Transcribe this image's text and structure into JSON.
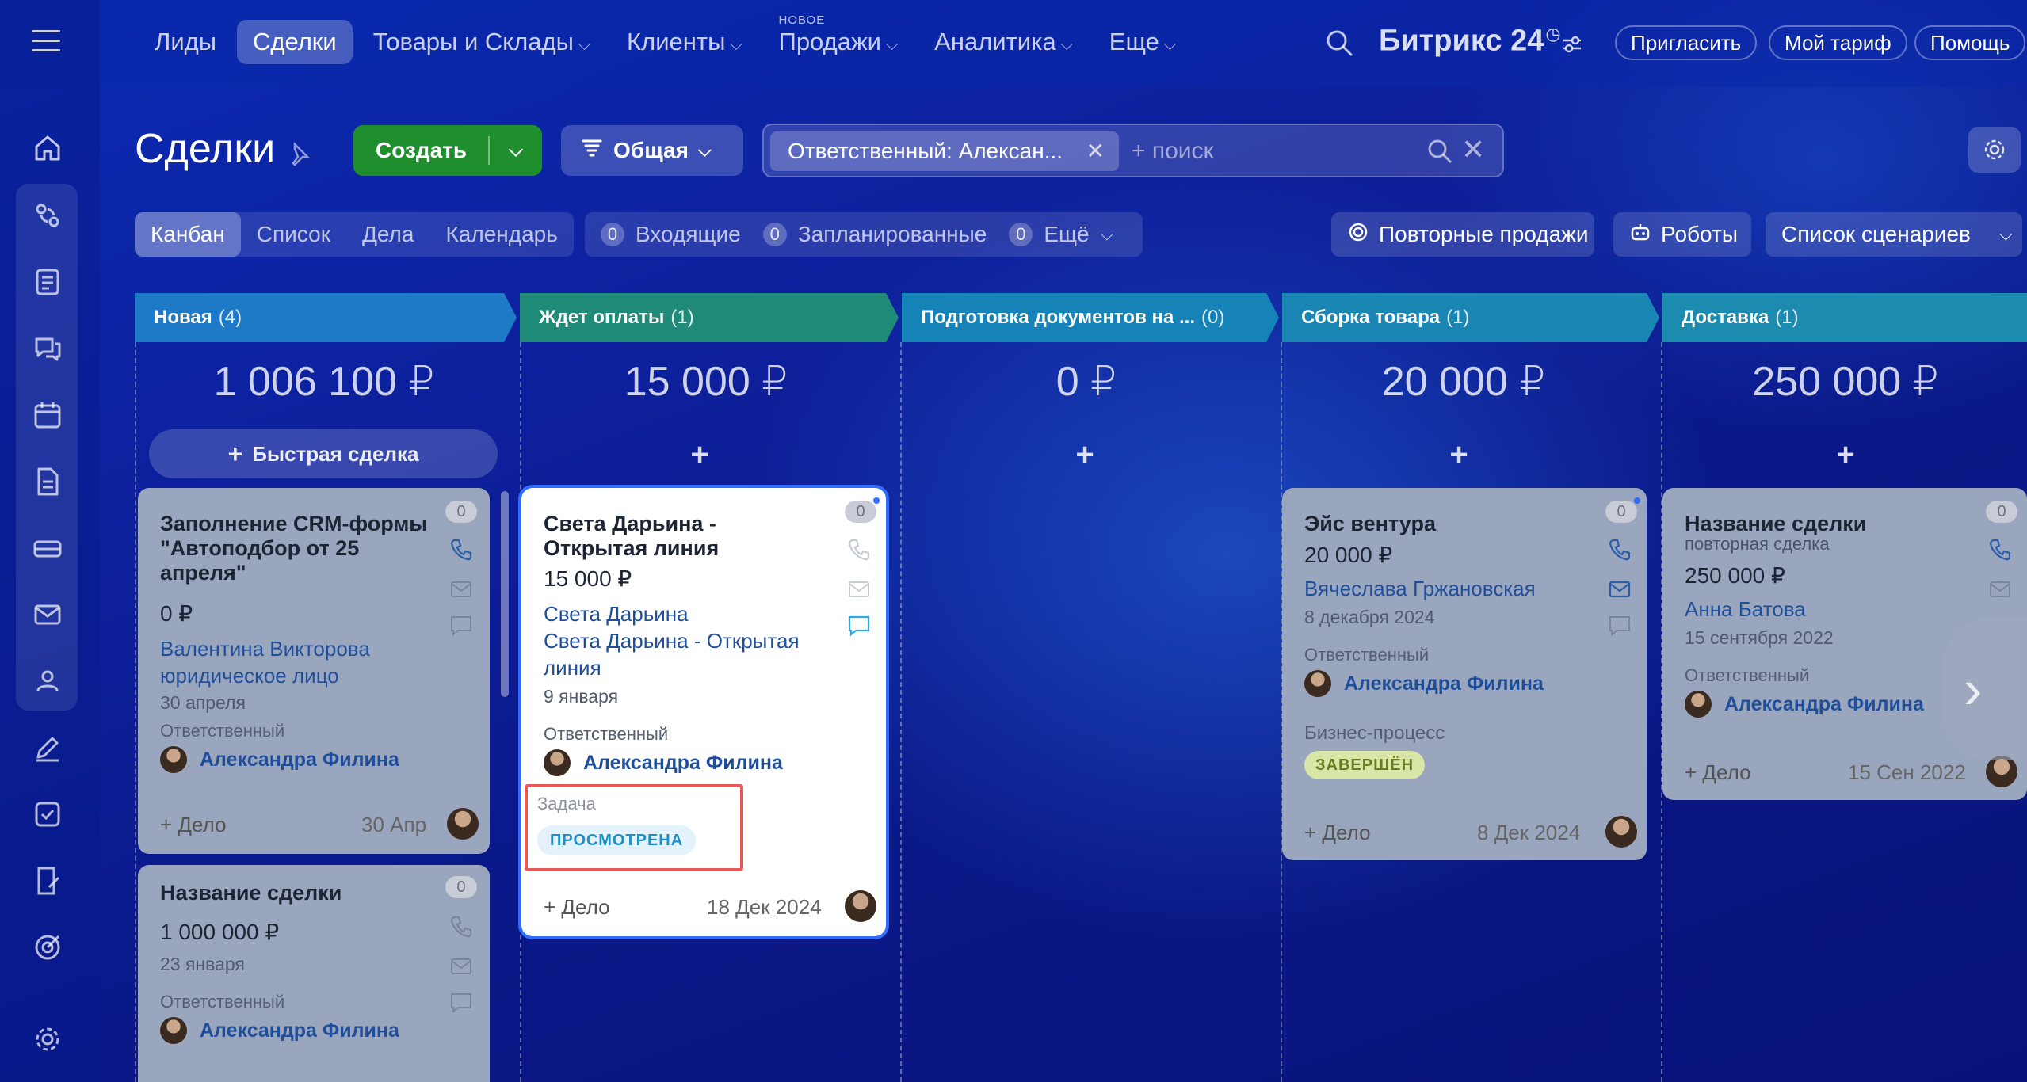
{
  "nav": {
    "items": [
      {
        "label": "Лиды",
        "active": false,
        "chevron": false
      },
      {
        "label": "Сделки",
        "active": true,
        "chevron": false
      },
      {
        "label": "Товары и Склады",
        "active": false,
        "chevron": true
      },
      {
        "label": "Клиенты",
        "active": false,
        "chevron": true
      },
      {
        "label": "Продажи",
        "active": false,
        "chevron": true,
        "badge": "НОВОЕ"
      },
      {
        "label": "Аналитика",
        "active": false,
        "chevron": true
      },
      {
        "label": "Еще",
        "active": false,
        "chevron": true
      }
    ],
    "brand": "Битрикс 24",
    "invite": "Пригласить",
    "tariff": "Мой тариф",
    "help": "Помощь"
  },
  "rail_icons": [
    "home-icon",
    "crm-icon",
    "feed-icon",
    "chat-icon",
    "calendar-icon",
    "document-icon",
    "storage-icon",
    "mail-icon",
    "group-icon",
    "sign-icon",
    "tasks-icon",
    "contract-icon",
    "target-icon",
    "settings-icon"
  ],
  "page": {
    "title": "Сделки",
    "create": "Создать",
    "preset": "Общая",
    "filter_chip": "Ответственный: Алексан...",
    "search_placeholder": "+ поиск"
  },
  "views": [
    "Канбан",
    "Список",
    "Дела",
    "Календарь"
  ],
  "counters": [
    {
      "num": "0",
      "label": "Входящие"
    },
    {
      "num": "0",
      "label": "Запланированные"
    },
    {
      "num": "0",
      "label": "Ещё"
    }
  ],
  "right_buttons": {
    "repeat": "Повторные продажи",
    "robots": "Роботы",
    "scenarios": "Список сценариев"
  },
  "stages": [
    {
      "name": "Новая",
      "count": "(4)",
      "sum": "1 006 100 ₽",
      "color": "#1e79c7"
    },
    {
      "name": "Ждет оплаты",
      "count": "(1)",
      "sum": "15 000 ₽",
      "color": "#1f8a78"
    },
    {
      "name": "Подготовка документов на ...",
      "count": "(0)",
      "sum": "0 ₽",
      "color": "#1583b8"
    },
    {
      "name": "Сборка товара",
      "count": "(1)",
      "sum": "20 000 ₽",
      "color": "#1a86b4"
    },
    {
      "name": "Доставка",
      "count": "(1)",
      "sum": "250 000 ₽",
      "color": "#1b8bb0"
    }
  ],
  "quick_deal": "Быстрая сделка",
  "cards": {
    "c1": {
      "title": "Заполнение CRM-формы \"Автоподбор от 25 апреля\"",
      "amount": "0 ₽",
      "client": "Валентина Викторова",
      "client2": "юридическое лицо",
      "date": "30 апреля",
      "resp_label": "Ответственный",
      "resp": "Александра Филина",
      "add": "+ Дело",
      "deadline": "30 Апр",
      "counter": "0"
    },
    "c2": {
      "title": "Название сделки",
      "amount": "1 000 000 ₽",
      "date": "23 января",
      "resp_label": "Ответственный",
      "resp": "Александра Филина",
      "counter": "0"
    },
    "c3": {
      "title": "Света Дарьина - Открытая линия",
      "amount": "15 000 ₽",
      "client": "Света Дарьина",
      "client2": "Света Дарьина - Открытая линия",
      "date": "9 января",
      "resp_label": "Ответственный",
      "resp": "Александра Филина",
      "task_label": "Задача",
      "task_status": "ПРОСМОТРЕНА",
      "add": "+ Дело",
      "deadline": "18 Дек 2024",
      "counter": "0"
    },
    "c4": {
      "title": "Эйс вентура",
      "amount": "20 000 ₽",
      "client": "Вячеслава Гржановская",
      "date": "8 декабря 2024",
      "resp_label": "Ответственный",
      "resp": "Александра Филина",
      "bp_label": "Бизнес-процесс",
      "bp_status": "ЗАВЕРШЁН",
      "add": "+ Дело",
      "deadline": "8 Дек 2024",
      "counter": "0"
    },
    "c5": {
      "title": "Название сделки",
      "subtitle": "повторная сделка",
      "amount": "250 000 ₽",
      "client": "Анна Батова",
      "date": "15 сентября 2022",
      "resp_label": "Ответственный",
      "resp": "Александра Филина",
      "add": "+ Дело",
      "deadline": "15 Сен 2022",
      "counter": "0"
    }
  }
}
